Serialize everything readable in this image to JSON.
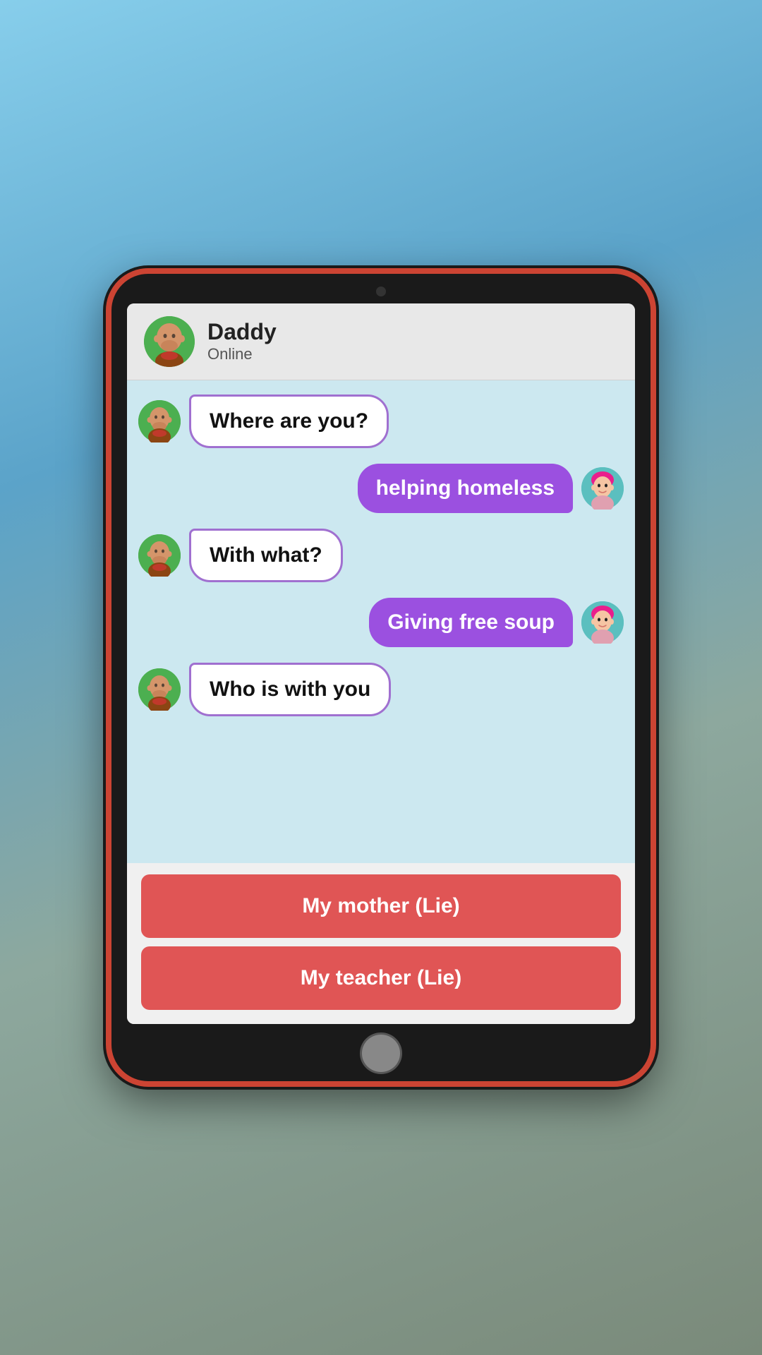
{
  "background": {
    "description": "blurred outdoor scene with sky"
  },
  "tablet": {
    "border_color": "#cc4433"
  },
  "chat": {
    "contact": {
      "name": "Daddy",
      "status": "Online"
    },
    "messages": [
      {
        "id": 1,
        "side": "left",
        "text": "Where are you?",
        "avatar": "daddy"
      },
      {
        "id": 2,
        "side": "right",
        "text": "helping homeless",
        "avatar": "player"
      },
      {
        "id": 3,
        "side": "left",
        "text": "With what?",
        "avatar": "daddy"
      },
      {
        "id": 4,
        "side": "right",
        "text": "Giving free soup",
        "avatar": "player"
      },
      {
        "id": 5,
        "side": "left",
        "text": "Who is with you",
        "avatar": "daddy"
      }
    ]
  },
  "choices": [
    {
      "id": 1,
      "label": "My mother (Lie)",
      "type": "lie"
    },
    {
      "id": 2,
      "label": "My teacher (Lie)",
      "type": "lie"
    }
  ],
  "icons": {
    "daddy_emoji": "👴",
    "player_emoji": "👩"
  }
}
